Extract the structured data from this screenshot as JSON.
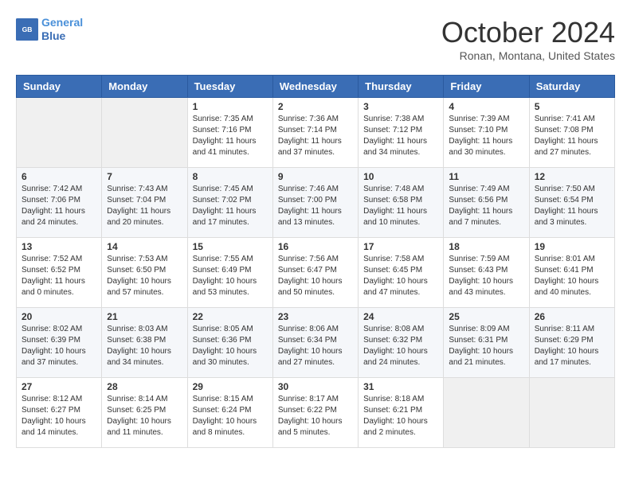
{
  "header": {
    "logo_line1": "General",
    "logo_line2": "Blue",
    "month_title": "October 2024",
    "location": "Ronan, Montana, United States"
  },
  "weekdays": [
    "Sunday",
    "Monday",
    "Tuesday",
    "Wednesday",
    "Thursday",
    "Friday",
    "Saturday"
  ],
  "weeks": [
    [
      {
        "day": "",
        "info": ""
      },
      {
        "day": "",
        "info": ""
      },
      {
        "day": "1",
        "info": "Sunrise: 7:35 AM\nSunset: 7:16 PM\nDaylight: 11 hours and 41 minutes."
      },
      {
        "day": "2",
        "info": "Sunrise: 7:36 AM\nSunset: 7:14 PM\nDaylight: 11 hours and 37 minutes."
      },
      {
        "day": "3",
        "info": "Sunrise: 7:38 AM\nSunset: 7:12 PM\nDaylight: 11 hours and 34 minutes."
      },
      {
        "day": "4",
        "info": "Sunrise: 7:39 AM\nSunset: 7:10 PM\nDaylight: 11 hours and 30 minutes."
      },
      {
        "day": "5",
        "info": "Sunrise: 7:41 AM\nSunset: 7:08 PM\nDaylight: 11 hours and 27 minutes."
      }
    ],
    [
      {
        "day": "6",
        "info": "Sunrise: 7:42 AM\nSunset: 7:06 PM\nDaylight: 11 hours and 24 minutes."
      },
      {
        "day": "7",
        "info": "Sunrise: 7:43 AM\nSunset: 7:04 PM\nDaylight: 11 hours and 20 minutes."
      },
      {
        "day": "8",
        "info": "Sunrise: 7:45 AM\nSunset: 7:02 PM\nDaylight: 11 hours and 17 minutes."
      },
      {
        "day": "9",
        "info": "Sunrise: 7:46 AM\nSunset: 7:00 PM\nDaylight: 11 hours and 13 minutes."
      },
      {
        "day": "10",
        "info": "Sunrise: 7:48 AM\nSunset: 6:58 PM\nDaylight: 11 hours and 10 minutes."
      },
      {
        "day": "11",
        "info": "Sunrise: 7:49 AM\nSunset: 6:56 PM\nDaylight: 11 hours and 7 minutes."
      },
      {
        "day": "12",
        "info": "Sunrise: 7:50 AM\nSunset: 6:54 PM\nDaylight: 11 hours and 3 minutes."
      }
    ],
    [
      {
        "day": "13",
        "info": "Sunrise: 7:52 AM\nSunset: 6:52 PM\nDaylight: 11 hours and 0 minutes."
      },
      {
        "day": "14",
        "info": "Sunrise: 7:53 AM\nSunset: 6:50 PM\nDaylight: 10 hours and 57 minutes."
      },
      {
        "day": "15",
        "info": "Sunrise: 7:55 AM\nSunset: 6:49 PM\nDaylight: 10 hours and 53 minutes."
      },
      {
        "day": "16",
        "info": "Sunrise: 7:56 AM\nSunset: 6:47 PM\nDaylight: 10 hours and 50 minutes."
      },
      {
        "day": "17",
        "info": "Sunrise: 7:58 AM\nSunset: 6:45 PM\nDaylight: 10 hours and 47 minutes."
      },
      {
        "day": "18",
        "info": "Sunrise: 7:59 AM\nSunset: 6:43 PM\nDaylight: 10 hours and 43 minutes."
      },
      {
        "day": "19",
        "info": "Sunrise: 8:01 AM\nSunset: 6:41 PM\nDaylight: 10 hours and 40 minutes."
      }
    ],
    [
      {
        "day": "20",
        "info": "Sunrise: 8:02 AM\nSunset: 6:39 PM\nDaylight: 10 hours and 37 minutes."
      },
      {
        "day": "21",
        "info": "Sunrise: 8:03 AM\nSunset: 6:38 PM\nDaylight: 10 hours and 34 minutes."
      },
      {
        "day": "22",
        "info": "Sunrise: 8:05 AM\nSunset: 6:36 PM\nDaylight: 10 hours and 30 minutes."
      },
      {
        "day": "23",
        "info": "Sunrise: 8:06 AM\nSunset: 6:34 PM\nDaylight: 10 hours and 27 minutes."
      },
      {
        "day": "24",
        "info": "Sunrise: 8:08 AM\nSunset: 6:32 PM\nDaylight: 10 hours and 24 minutes."
      },
      {
        "day": "25",
        "info": "Sunrise: 8:09 AM\nSunset: 6:31 PM\nDaylight: 10 hours and 21 minutes."
      },
      {
        "day": "26",
        "info": "Sunrise: 8:11 AM\nSunset: 6:29 PM\nDaylight: 10 hours and 17 minutes."
      }
    ],
    [
      {
        "day": "27",
        "info": "Sunrise: 8:12 AM\nSunset: 6:27 PM\nDaylight: 10 hours and 14 minutes."
      },
      {
        "day": "28",
        "info": "Sunrise: 8:14 AM\nSunset: 6:25 PM\nDaylight: 10 hours and 11 minutes."
      },
      {
        "day": "29",
        "info": "Sunrise: 8:15 AM\nSunset: 6:24 PM\nDaylight: 10 hours and 8 minutes."
      },
      {
        "day": "30",
        "info": "Sunrise: 8:17 AM\nSunset: 6:22 PM\nDaylight: 10 hours and 5 minutes."
      },
      {
        "day": "31",
        "info": "Sunrise: 8:18 AM\nSunset: 6:21 PM\nDaylight: 10 hours and 2 minutes."
      },
      {
        "day": "",
        "info": ""
      },
      {
        "day": "",
        "info": ""
      }
    ]
  ]
}
